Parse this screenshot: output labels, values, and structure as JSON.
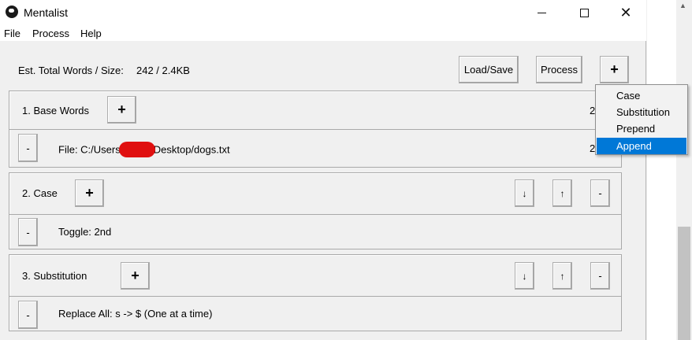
{
  "window": {
    "title": "Mentalist"
  },
  "menu": {
    "file": "File",
    "process": "Process",
    "help": "Help"
  },
  "toolbar": {
    "est_label": "Est. Total Words / Size:",
    "est_value": "242 / 2.4KB",
    "load_save": "Load/Save",
    "process": "Process",
    "add": "+"
  },
  "dropdown": {
    "items": [
      "Case",
      "Substitution",
      "Prepend",
      "Append"
    ],
    "selected": "Append"
  },
  "panels": [
    {
      "title": "1. Base Words",
      "count": "2",
      "rows": [
        {
          "prefix": "File: C:/Users",
          "suffix": "Desktop/dogs.txt",
          "count": "2"
        }
      ]
    },
    {
      "title": "2. Case",
      "down": "↓",
      "up": "↑",
      "remove": "-",
      "rows": [
        {
          "text": "Toggle: 2nd"
        }
      ]
    },
    {
      "title": "3. Substitution",
      "down": "↓",
      "up": "↑",
      "remove": "-",
      "rows": [
        {
          "text": "Replace All: s -> $ (One at a time)"
        }
      ]
    }
  ],
  "labels": {
    "plus": "+",
    "minus": "-"
  },
  "colors": {
    "selection": "#0078d7",
    "redaction": "#e01010"
  }
}
